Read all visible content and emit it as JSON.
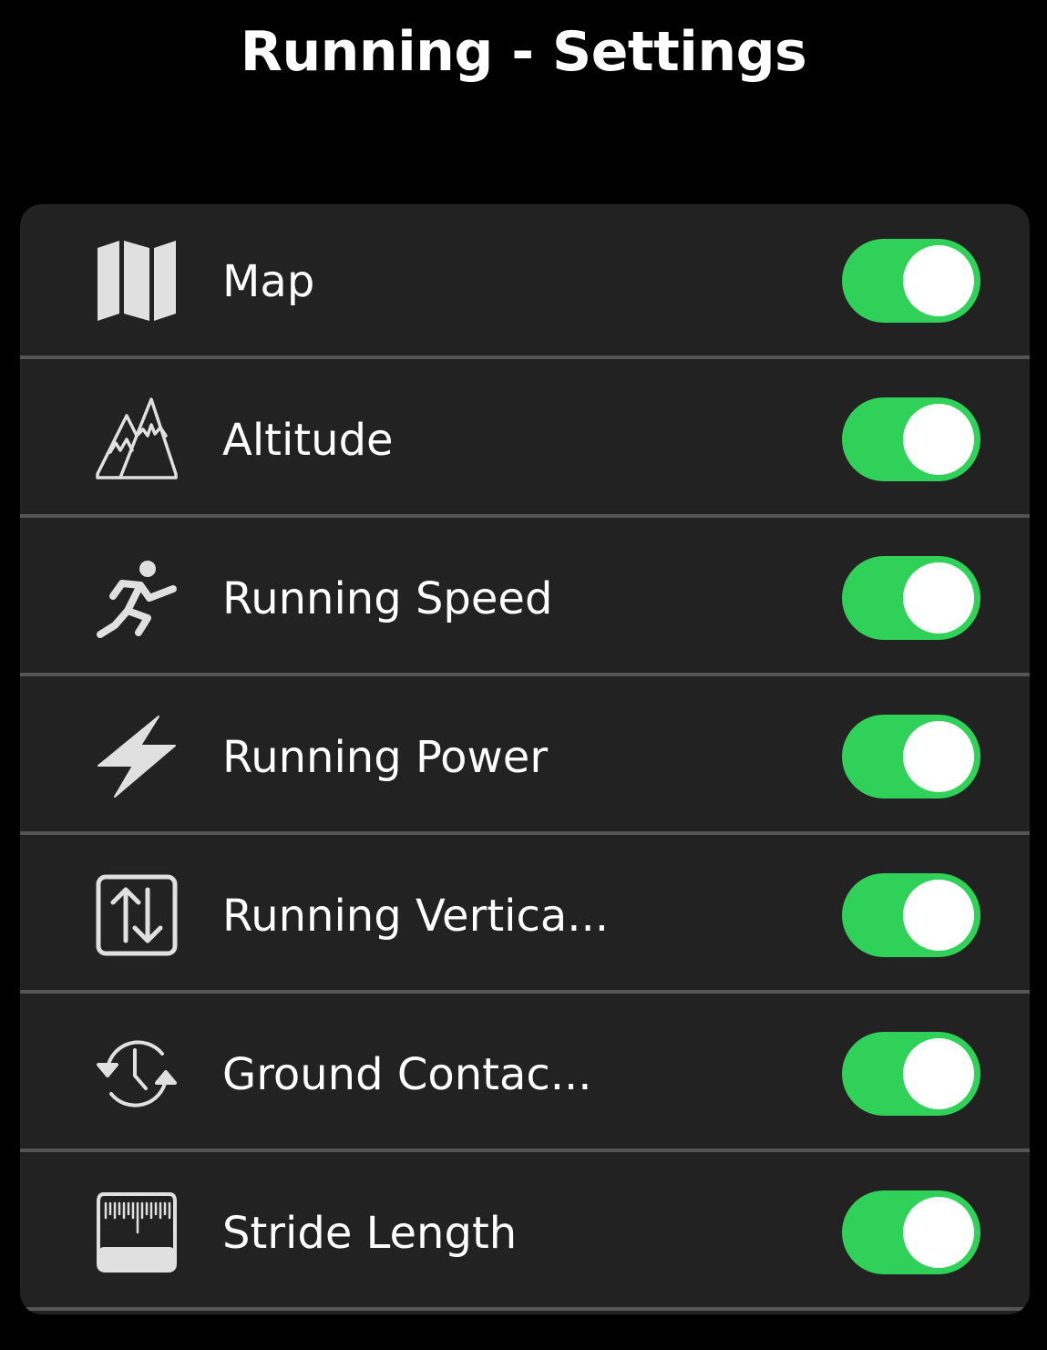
{
  "screen": {
    "title": "Running - Settings"
  },
  "colors": {
    "background": "#000000",
    "list_background": "#222222",
    "divider": "#555555",
    "toggle_on": "#30D158",
    "toggle_off": "#39393D",
    "icon": "#E0E0E0",
    "text": "#FFFFFF"
  },
  "settings": [
    {
      "label": "Map",
      "icon": "map-icon",
      "enabled": true
    },
    {
      "label": "Altitude",
      "icon": "mountains-icon",
      "enabled": true
    },
    {
      "label": "Running Speed",
      "icon": "runner-icon",
      "enabled": true
    },
    {
      "label": "Running Power",
      "icon": "lightning-bolt-icon",
      "enabled": true
    },
    {
      "label": "Running Vertica...",
      "icon": "vertical-arrows-icon",
      "enabled": true
    },
    {
      "label": "Ground Contac...",
      "icon": "clock-cycle-icon",
      "enabled": true
    },
    {
      "label": "Stride Length",
      "icon": "ruler-gauge-icon",
      "enabled": true
    }
  ]
}
